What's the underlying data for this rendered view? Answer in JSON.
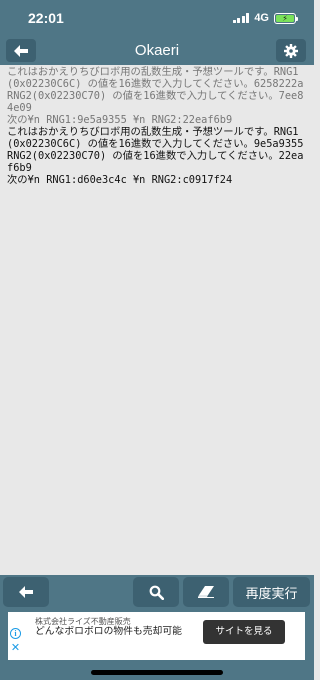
{
  "status_bar": {
    "time": "22:01",
    "network": "4G",
    "battery_level": 1.0,
    "battery_color": "#7ae15a"
  },
  "header": {
    "title": "Okaeri",
    "back_icon": "arrow-left-icon",
    "settings_icon": "gear-icon",
    "bar_color": "#4f7686"
  },
  "log": {
    "old_lines": [
      "これはおかえりちびロボ用の乱数生成・予想ツールです。RNG1(0x02230C6C) の値を16進数で入力してください。6258222a",
      "RNG2(0x02230C70) の値を16進数で入力してください。7ee84e09",
      "次の¥n RNG1:9e5a9355 ¥n RNG2:22eaf6b9"
    ],
    "new_lines": [
      "これはおかえりちびロボ用の乱数生成・予想ツールです。RNG1(0x02230C6C) の値を16進数で入力してください。9e5a9355",
      "RNG2(0x02230C70) の値を16進数で入力してください。22eaf6b9",
      "次の¥n RNG1:d60e3c4c ¥n RNG2:c0917f24"
    ]
  },
  "toolbar": {
    "back_icon": "arrow-left-icon",
    "search_icon": "search-icon",
    "eraser_icon": "eraser-icon",
    "rerun_label": "再度実行"
  },
  "ad": {
    "company": "株式会社ライズ不動産販売",
    "text": "どんなボロボロの物件も売却可能",
    "cta": "サイトを見る"
  }
}
